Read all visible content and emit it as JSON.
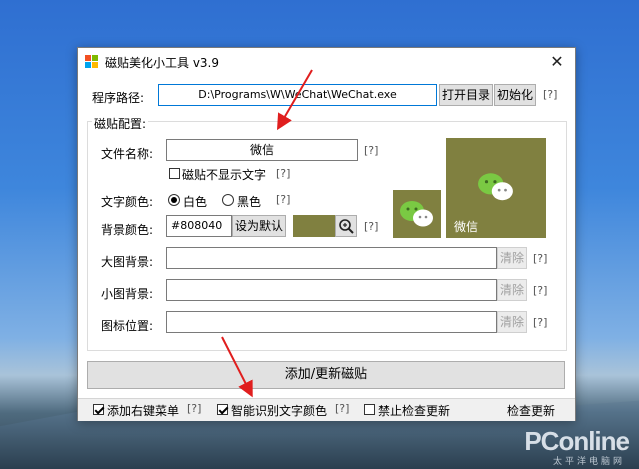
{
  "window": {
    "title": "磁贴美化小工具 v3.9",
    "close_symbol": "✕"
  },
  "path": {
    "label": "程序路径:",
    "value": "D:\\Programs\\W\\WeChat\\WeChat.exe",
    "open_dir_label": "打开目录",
    "init_label": "初始化",
    "help": "[?]"
  },
  "config": {
    "group_label": "磁贴配置:",
    "file_name_label": "文件名称:",
    "file_name_value": "微信",
    "file_name_help": "[?]",
    "hide_text_label": "磁贴不显示文字",
    "hide_text_help": "[?]",
    "text_color_label": "文字颜色:",
    "white_label": "白色",
    "black_label": "黑色",
    "text_color_help": "[?]",
    "bg_color_label": "背景颜色:",
    "bg_color_value": "#808040",
    "set_default_label": "设为默认",
    "bg_color_help": "[?]",
    "bg_swatch_color": "#808040",
    "large_bg_label": "大图背景:",
    "small_bg_label": "小图背景:",
    "icon_pos_label": "图标位置:",
    "clear_label": "清除",
    "row_help": "[?]"
  },
  "preview": {
    "large_tile_text": "微信",
    "tile_color": "#808040"
  },
  "actions": {
    "add_update_label": "添加/更新磁贴"
  },
  "status": {
    "context_menu_label": "添加右键菜单",
    "context_menu_help": "[?]",
    "smart_color_label": "智能识别文字颜色",
    "smart_color_help": "[?]",
    "no_update_label": "禁止检查更新",
    "check_update_label": "检查更新"
  },
  "watermark": {
    "brand": "PConline",
    "sub": "太平洋电脑网"
  }
}
